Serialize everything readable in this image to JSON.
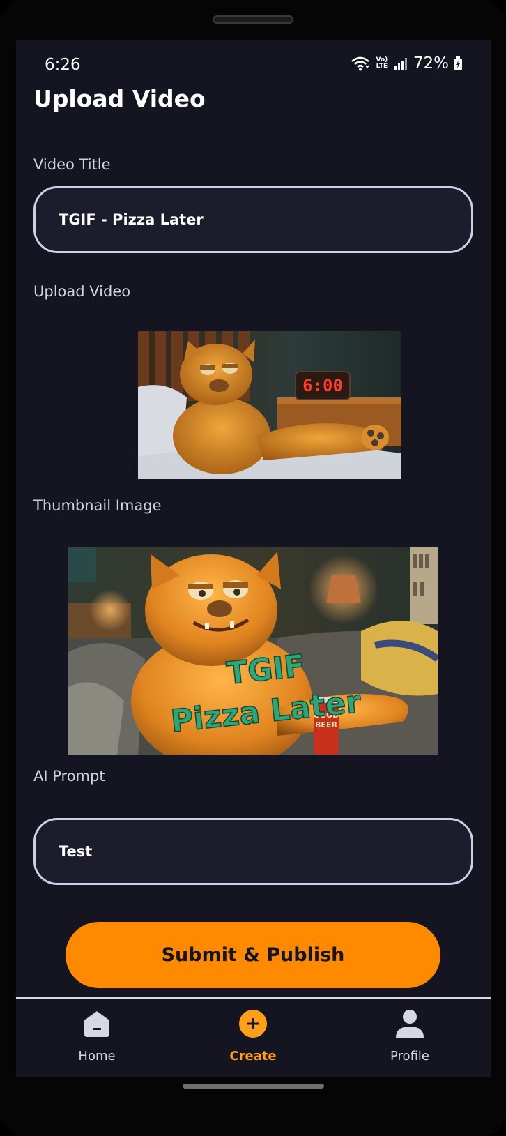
{
  "status_bar": {
    "time": "6:26",
    "network_label": "Vo) LTE",
    "battery_percent": "72%"
  },
  "page": {
    "title": "Upload Video"
  },
  "form": {
    "video_title_label": "Video Title",
    "video_title_value": "TGIF - Pizza Later",
    "upload_video_label": "Upload Video",
    "thumbnail_label": "Thumbnail Image",
    "ai_prompt_label": "AI Prompt",
    "ai_prompt_value": "Test",
    "submit_label": "Submit & Publish"
  },
  "media": {
    "video_preview": {
      "clock_text": "6:00"
    },
    "thumbnail": {
      "overlay_line1": "TGIF",
      "overlay_line2": "Pizza Later",
      "can_text_line1": "GOOD",
      "can_text_line2": "BEER"
    }
  },
  "bottom_nav": {
    "items": [
      {
        "label": "Home",
        "icon": "home-icon",
        "active": false
      },
      {
        "label": "Create",
        "icon": "plus-circle-icon",
        "active": true
      },
      {
        "label": "Profile",
        "icon": "person-icon",
        "active": false
      }
    ]
  },
  "colors": {
    "background": "#151522",
    "accent": "#ff8a00",
    "field_border": "#cfcfe3",
    "text_primary": "#ffffff",
    "text_secondary": "#d2d2dc"
  }
}
